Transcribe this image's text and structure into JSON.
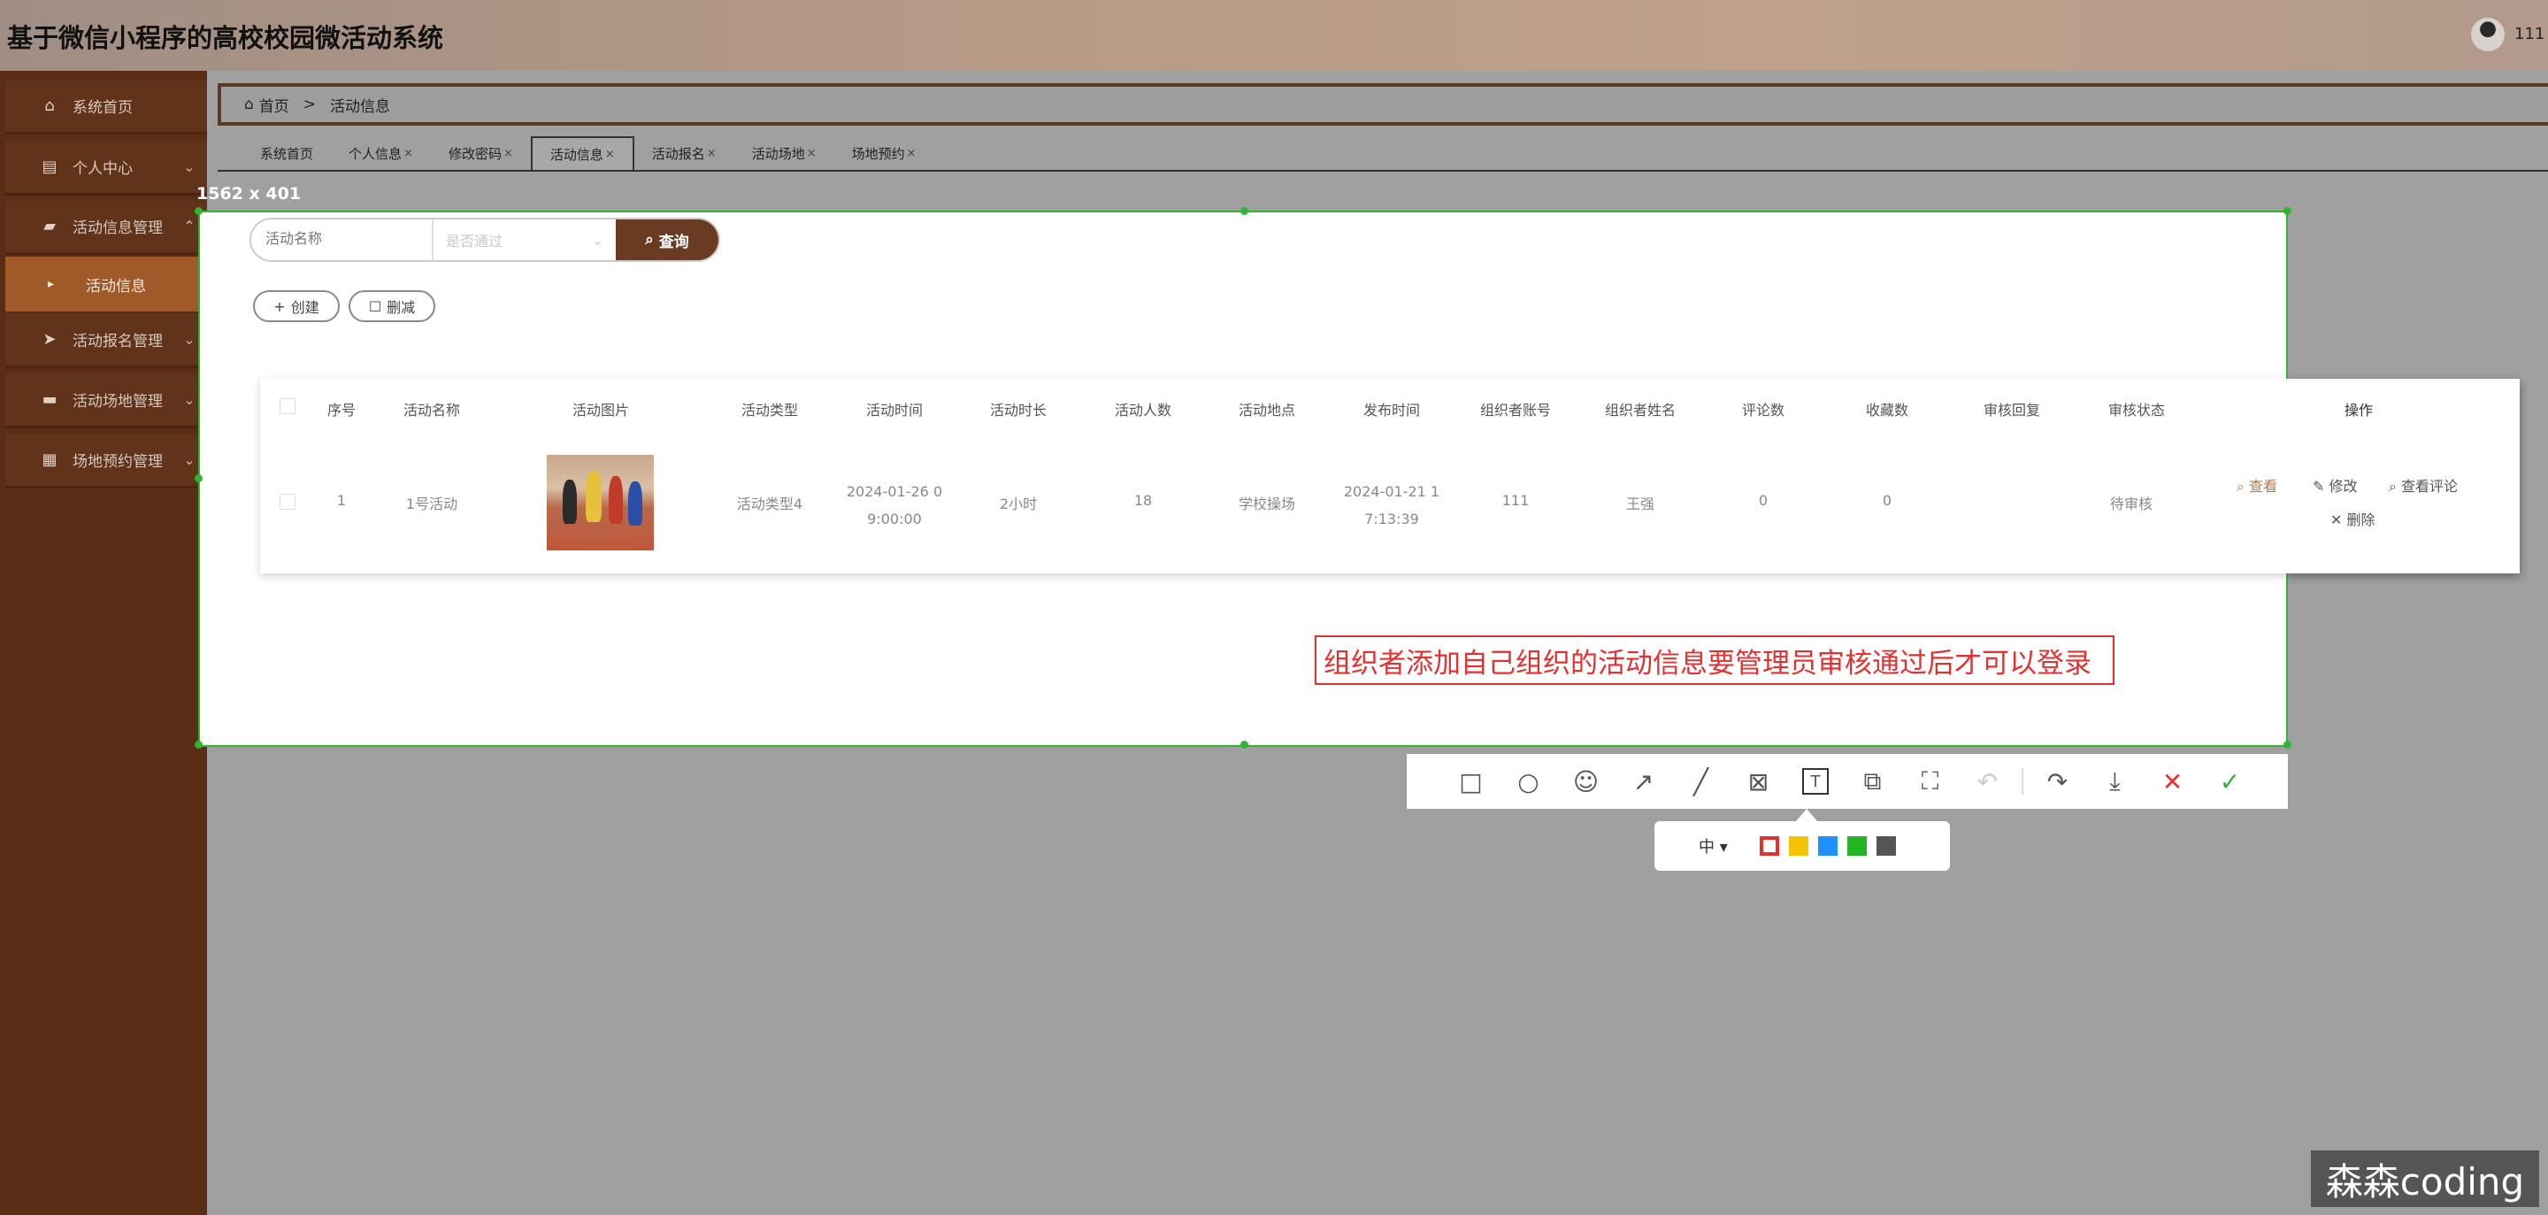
{
  "header": {
    "title": "基于微信小程序的高校校园微活动系统",
    "user": "111"
  },
  "sidebar": {
    "items": [
      {
        "label": "系统首页",
        "icon": "home-icon"
      },
      {
        "label": "个人中心",
        "icon": "calendar-icon"
      },
      {
        "label": "活动信息管理",
        "icon": "briefcase-icon"
      },
      {
        "label": "活动报名管理",
        "icon": "send-icon"
      },
      {
        "label": "活动场地管理",
        "icon": "printer-icon"
      },
      {
        "label": "场地预约管理",
        "icon": "grid-icon"
      }
    ],
    "active_sub": "活动信息"
  },
  "breadcrumb": {
    "home": "首页",
    "sep": ">",
    "current": "活动信息"
  },
  "tabs": [
    {
      "label": "系统首页",
      "closable": false
    },
    {
      "label": "个人信息",
      "closable": true
    },
    {
      "label": "修改密码",
      "closable": true
    },
    {
      "label": "活动信息",
      "closable": true,
      "active": true
    },
    {
      "label": "活动报名",
      "closable": true
    },
    {
      "label": "活动场地",
      "closable": true
    },
    {
      "label": "场地预约",
      "closable": true
    }
  ],
  "selection": {
    "size": "1562 x 401"
  },
  "search": {
    "name_placeholder": "活动名称",
    "status_placeholder": "是否通过",
    "query_label": "查询",
    "create_label": "创建",
    "delete_label": "删减"
  },
  "table": {
    "columns": [
      "序号",
      "活动名称",
      "活动图片",
      "活动类型",
      "活动时间",
      "活动时长",
      "活动人数",
      "活动地点",
      "发布时间",
      "组织者账号",
      "组织者姓名",
      "评论数",
      "收藏数",
      "审核回复",
      "审核状态",
      "操作"
    ],
    "row": {
      "index": "1",
      "name": "1号活动",
      "type": "活动类型4",
      "time_a": "2024-01-26 0",
      "time_b": "9:00:00",
      "duration": "2小时",
      "people": "18",
      "place": "学校操场",
      "pub_a": "2024-01-21 1",
      "pub_b": "7:13:39",
      "account": "111",
      "organizer": "王强",
      "comments": "0",
      "favorites": "0",
      "reply": "",
      "status": "待审核"
    },
    "actions": {
      "view": "查看",
      "edit": "修改",
      "view_comments": "查看评论",
      "delete": "删除"
    }
  },
  "annotation": {
    "text": "组织者添加自己组织的活动信息要管理员审核通过后才可以登录",
    "color": "#e53030"
  },
  "toolbar": {
    "tools": [
      "rectangle-icon",
      "circle-icon",
      "emoji-icon",
      "arrow-icon",
      "line-icon",
      "mosaic-icon",
      "text-icon",
      "copy-icon",
      "ocr-icon",
      "undo-icon",
      "redo-icon",
      "save-icon",
      "close-icon",
      "confirm-icon"
    ],
    "size_label": "中",
    "colors": [
      "#e53030",
      "#f5c400",
      "#1e90ff",
      "#22b522",
      "#555555"
    ]
  },
  "watermark": {
    "text": "森森coding"
  }
}
